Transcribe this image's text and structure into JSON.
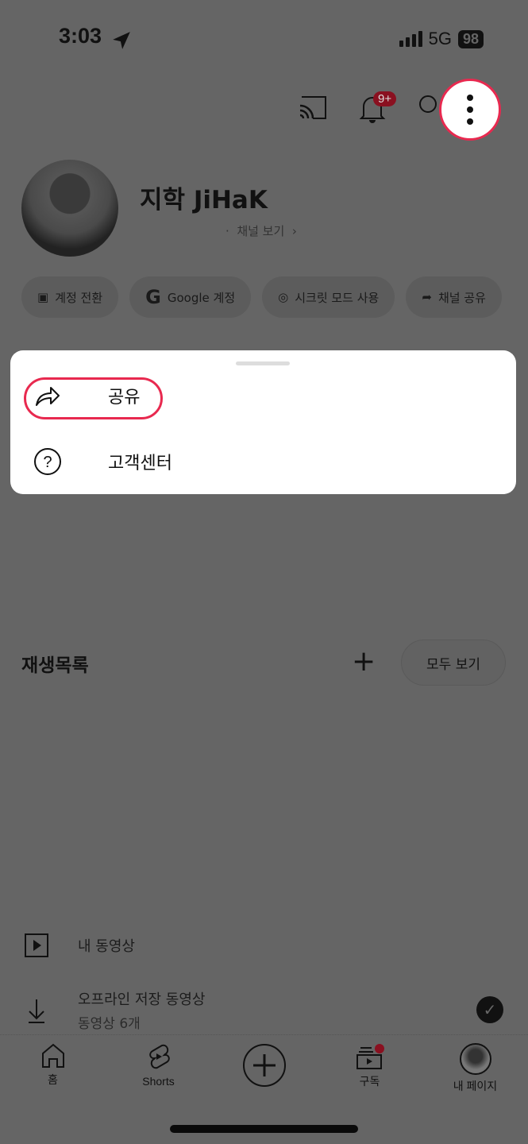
{
  "status": {
    "time": "3:03",
    "network": "5G",
    "battery": "98"
  },
  "header": {
    "notification_badge": "9+"
  },
  "profile": {
    "name": "지학 JiHaK",
    "channel_link": "채널 보기"
  },
  "chips": [
    {
      "icon": "switch-account-icon",
      "label": "계정 전환"
    },
    {
      "icon": "google-icon",
      "label": "Google 계정"
    },
    {
      "icon": "incognito-icon",
      "label": "시크릿 모드 사용"
    },
    {
      "icon": "share-icon",
      "label": "채널 공유"
    }
  ],
  "menu": {
    "items": [
      {
        "icon": "share-icon",
        "label": "공유"
      },
      {
        "icon": "help-icon",
        "label": "고객센터"
      }
    ]
  },
  "playlists": {
    "title": "재생목록",
    "see_all": "모두 보기"
  },
  "library": {
    "my_videos": "내 동영상",
    "offline_title": "오프라인 저장 동영상",
    "offline_sub": "동영상 6개"
  },
  "nav": {
    "items": [
      {
        "label": "홈"
      },
      {
        "label": "Shorts"
      },
      {
        "label": ""
      },
      {
        "label": "구독"
      },
      {
        "label": "내 페이지"
      }
    ]
  },
  "colors": {
    "highlight": "#e8294f",
    "badge": "#8a1020"
  }
}
